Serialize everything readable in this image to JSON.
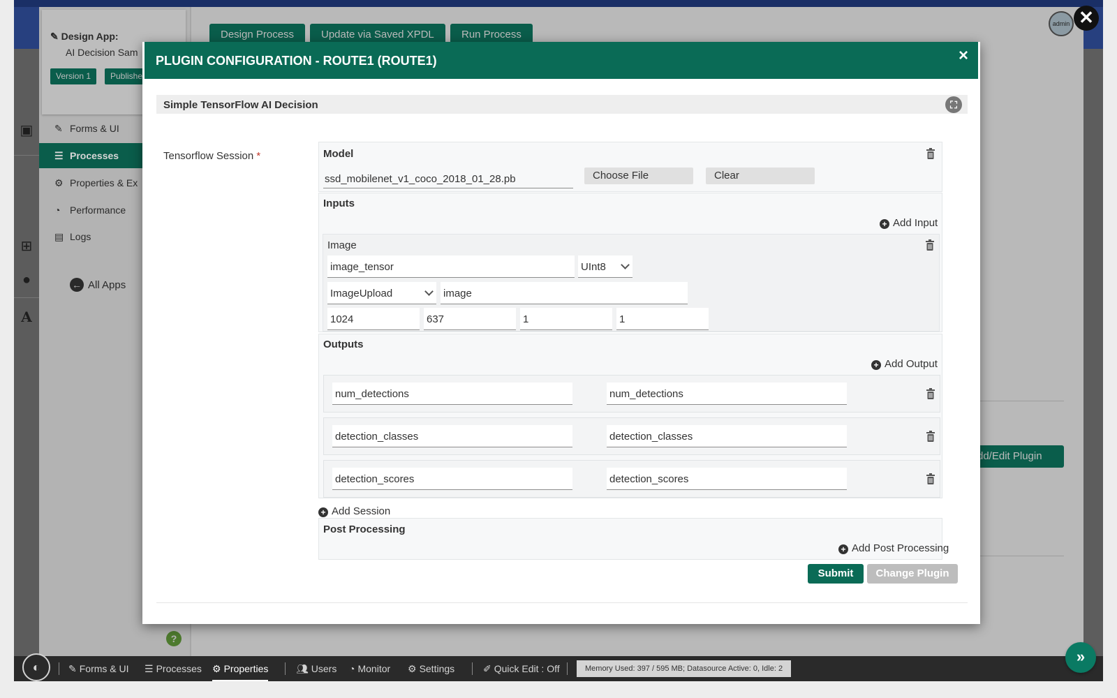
{
  "background": {
    "sidebar": {
      "title": "Design App:",
      "subtitle": "AI Decision Sam",
      "version_label": "Version 1",
      "publish_label": "Publishe",
      "items": [
        {
          "label": "Forms & UI",
          "icon": "edit-icon"
        },
        {
          "label": "Processes",
          "icon": "list-icon"
        },
        {
          "label": "Properties & Ex",
          "icon": "gear-icon"
        },
        {
          "label": "Performance",
          "icon": "gauge-icon"
        },
        {
          "label": "Logs",
          "icon": "scroll-icon"
        }
      ],
      "all_apps_label": "All Apps",
      "help_label": "?"
    },
    "tabs": [
      "Design Process",
      "Update via Saved XPDL",
      "Run Process"
    ],
    "plugin_button_label": "dd/Edit Plugin",
    "avatar_label": "admin"
  },
  "modal": {
    "title": "PLUGIN CONFIGURATION - ROUTE1 (ROUTE1)",
    "close_label": "×",
    "section_title": "Simple TensorFlow AI Decision",
    "field_label": "Tensorflow Session",
    "required_mark": "*",
    "model": {
      "title": "Model",
      "file_value": "ssd_mobilenet_v1_coco_2018_01_28.pb",
      "choose_file_label": "Choose File",
      "clear_label": "Clear"
    },
    "inputs": {
      "title": "Inputs",
      "add_label": "Add Input",
      "image_group_title": "Image",
      "tensor_name": "image_tensor",
      "dtype": "UInt8",
      "source_type": "ImageUpload",
      "source_field": "image",
      "dims": [
        "1024",
        "637",
        "1",
        "1"
      ]
    },
    "outputs": {
      "title": "Outputs",
      "add_label": "Add Output",
      "rows": [
        {
          "name": "num_detections",
          "variable": "num_detections"
        },
        {
          "name": "detection_classes",
          "variable": "detection_classes"
        },
        {
          "name": "detection_scores",
          "variable": "detection_scores"
        }
      ]
    },
    "add_session_label": "Add Session",
    "post_processing": {
      "title": "Post Processing",
      "add_label": "Add Post Processing"
    },
    "submit_label": "Submit",
    "change_plugin_label": "Change Plugin"
  },
  "bottombar": {
    "items": [
      {
        "label": "Forms & UI",
        "icon": "edit-icon"
      },
      {
        "label": "Processes",
        "icon": "list-icon"
      },
      {
        "label": "Properties",
        "icon": "gear-icon"
      },
      {
        "label": "Users",
        "icon": "users-icon"
      },
      {
        "label": "Monitor",
        "icon": "gauge-icon"
      },
      {
        "label": "Settings",
        "icon": "gears-icon"
      },
      {
        "label": "Quick Edit : Off",
        "icon": "brush-icon"
      }
    ],
    "status": "Memory Used: 397 / 595 MB; Datasource Active: 0, Idle: 2"
  },
  "colors": {
    "accent": "#0a6b56",
    "header_navy": "#27407f",
    "bottombar": "#2a2a2a"
  }
}
